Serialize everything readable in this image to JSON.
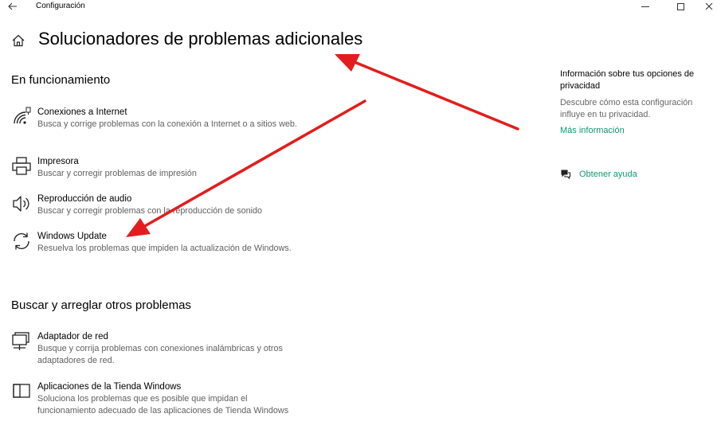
{
  "window": {
    "title": "Configuración",
    "back_icon": "arrow-left-icon",
    "minimize_icon": "minimize-icon",
    "maximize_icon": "maximize-icon",
    "close_icon": "close-icon",
    "close_glyph": "✕"
  },
  "page": {
    "title": "Solucionadores de problemas adicionales",
    "home_icon": "home-icon"
  },
  "sections": {
    "running": {
      "title": "En funcionamiento",
      "items": [
        {
          "title": "Conexiones a Internet",
          "description": "Busca y corrige problemas con la conexión a Internet o a sitios web.",
          "icon": "wifi-signal-icon"
        },
        {
          "title": "Impresora",
          "description": "Buscar y corregir problemas de impresión",
          "icon": "printer-icon"
        },
        {
          "title": "Reproducción de audio",
          "description": "Buscar y corregir problemas con la reproducción de sonido",
          "icon": "speaker-icon"
        },
        {
          "title": "Windows Update",
          "description": "Resuelva los problemas que impiden la actualización de Windows.",
          "icon": "sync-icon"
        }
      ]
    },
    "other": {
      "title": "Buscar y arreglar otros problemas",
      "items": [
        {
          "title": "Adaptador de red",
          "description": "Busque y corrija problemas con conexiones inalámbricas y otros adaptadores de red.",
          "icon": "network-adapter-icon"
        },
        {
          "title": "Aplicaciones de la Tienda Windows",
          "description": "Soluciona los problemas que es posible que impidan el funcionamiento adecuado de las aplicaciones de Tienda Windows",
          "icon": "store-app-icon"
        }
      ]
    }
  },
  "sidebar": {
    "privacy_heading": "Información sobre tus opciones de privacidad",
    "privacy_description": "Descubre cómo esta configuración influye en tu privacidad.",
    "more_info_link": "Más información",
    "help_link": "Obtener ayuda",
    "help_icon": "help-chat-icon"
  },
  "colors": {
    "accent_link": "#0f9a6a",
    "annotation_arrow": "#e31d1d",
    "secondary_text": "#5f5f5f"
  }
}
